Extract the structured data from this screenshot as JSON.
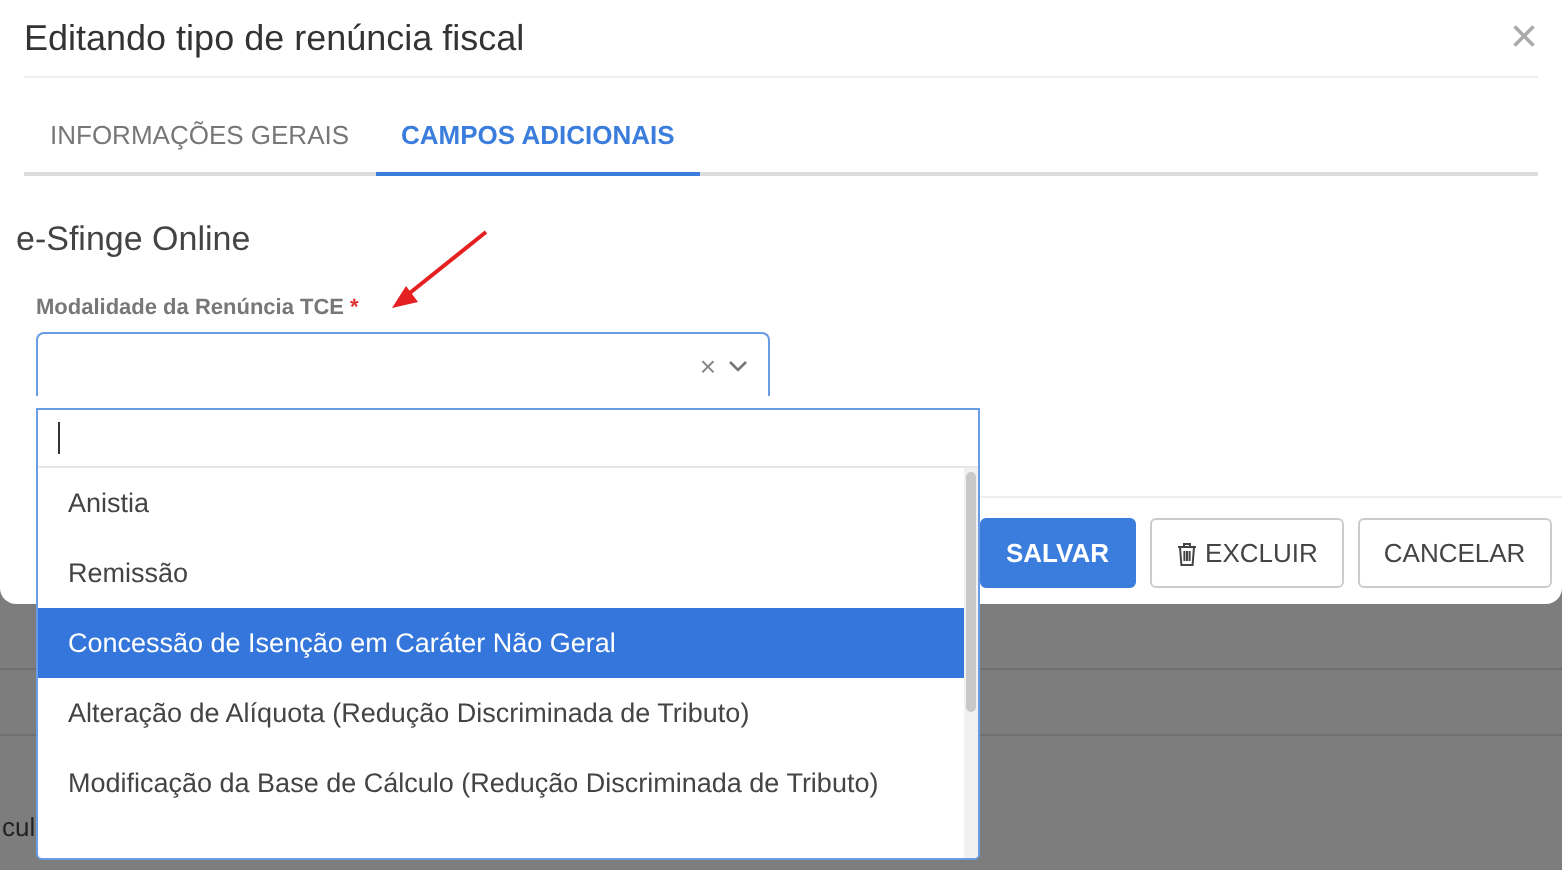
{
  "modal": {
    "title": "Editando tipo de renúncia fiscal",
    "close_icon": "×",
    "tabs": [
      {
        "label": "INFORMAÇÕES GERAIS",
        "selected": false
      },
      {
        "label": "CAMPOS ADICIONAIS",
        "selected": true
      }
    ],
    "section_title": "e-Sfinge Online",
    "field": {
      "label": "Modalidade da Renúncia TCE",
      "required": true,
      "required_mark": "*",
      "clear_icon": "×"
    },
    "buttons": [
      {
        "label": "SALVAR",
        "kind": "primary"
      },
      {
        "label": "EXCLUIR",
        "kind": "delete"
      },
      {
        "label": "CANCELAR",
        "kind": "plain"
      }
    ]
  },
  "dropdown": {
    "options": [
      {
        "label": "Anistia",
        "selected": false
      },
      {
        "label": "Remissão",
        "selected": false
      },
      {
        "label": "Concessão de Isenção em Caráter Não Geral",
        "selected": true
      },
      {
        "label": "Alteração de Alíquota (Redução Discriminada de Tributo)",
        "selected": false
      },
      {
        "label": "Modificação da Base de Cálculo (Redução Discriminada de Tributo)",
        "selected": false
      }
    ]
  },
  "background": {
    "text": "cul"
  }
}
